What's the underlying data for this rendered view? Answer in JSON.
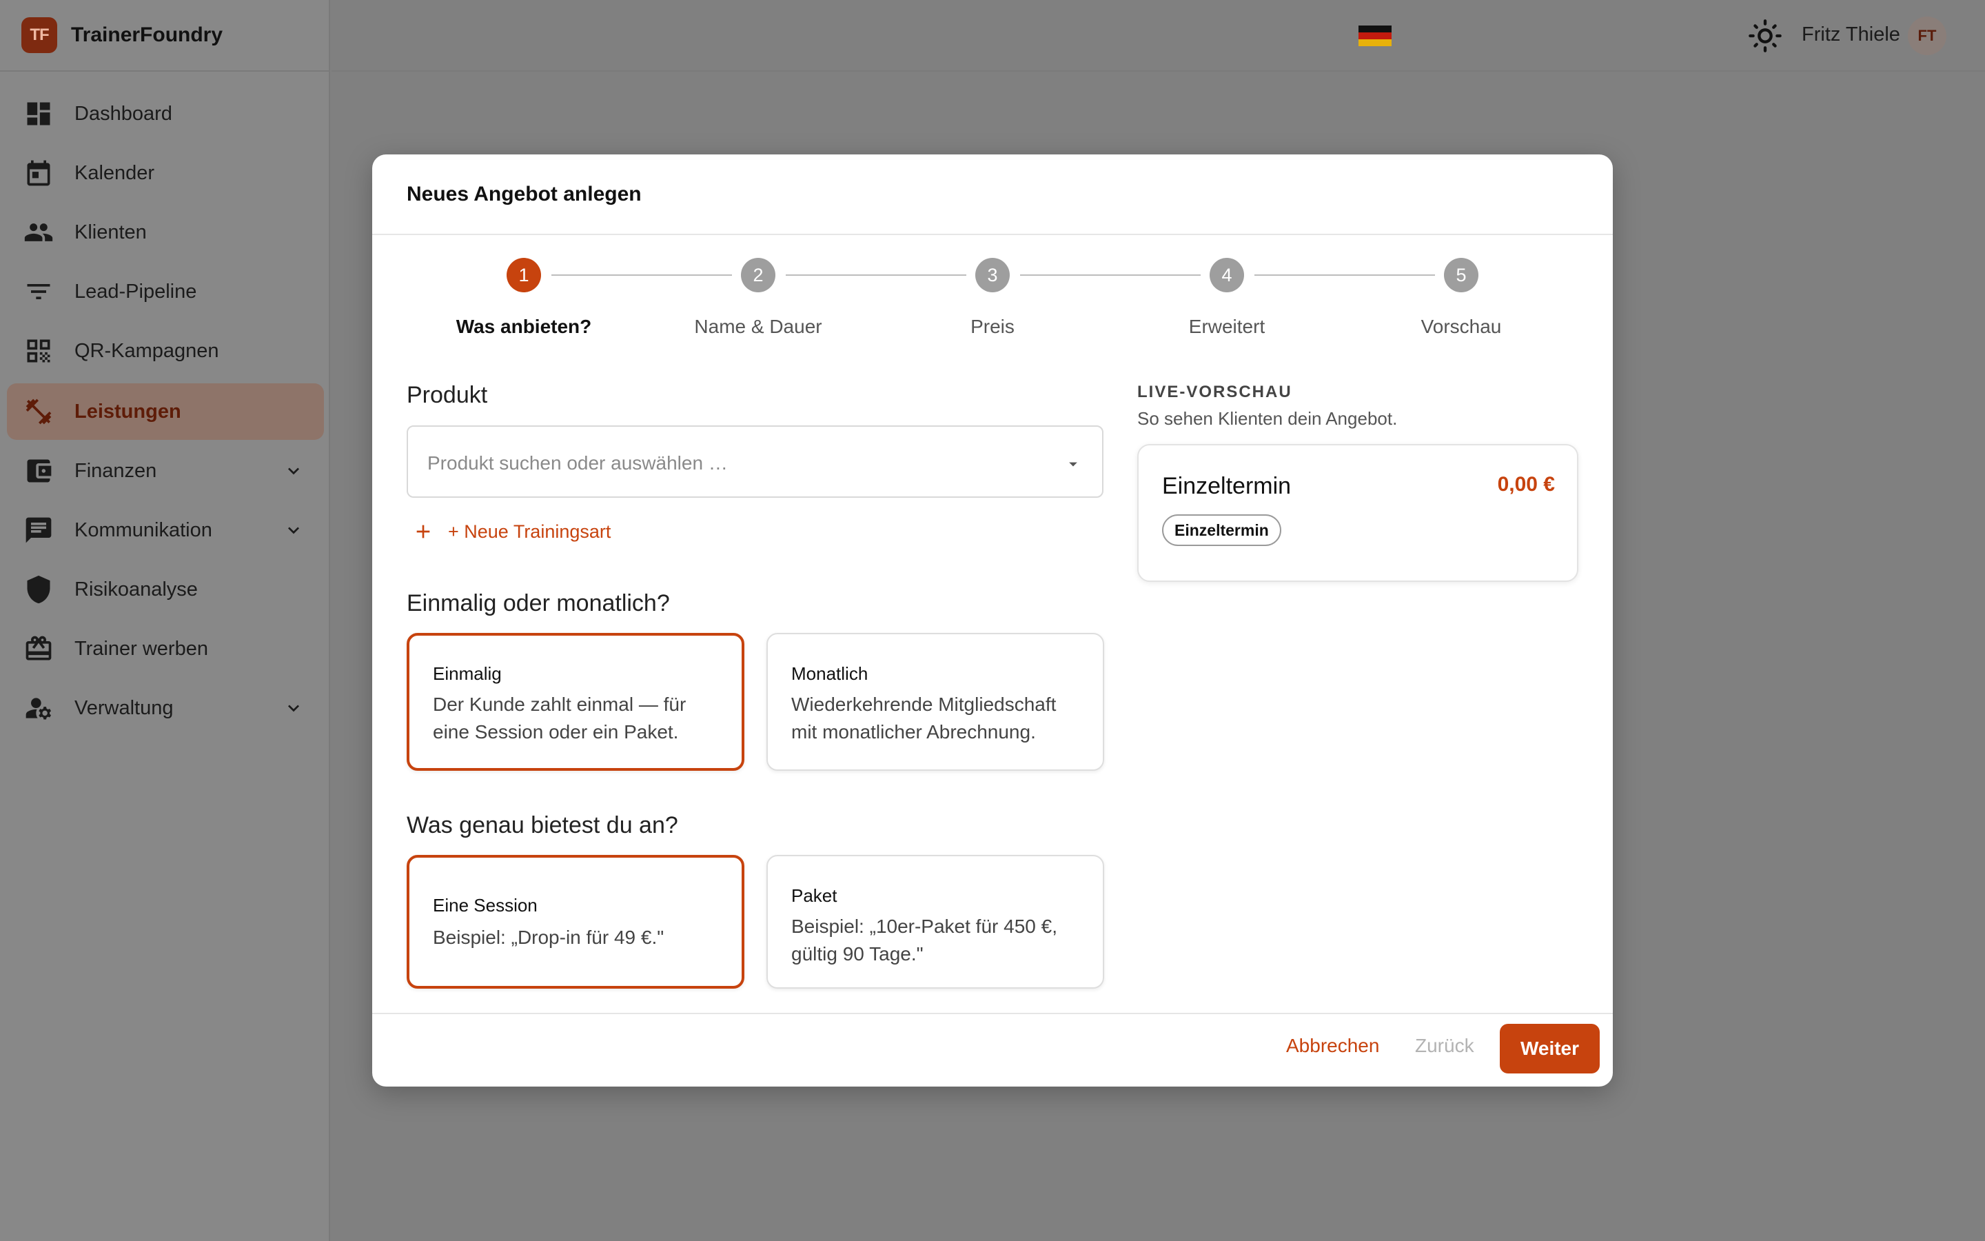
{
  "app": {
    "logo": "TF",
    "name": "TrainerFoundry"
  },
  "sidebar": {
    "items": [
      {
        "label": "Dashboard",
        "icon": "dashboard-icon"
      },
      {
        "label": "Kalender",
        "icon": "calendar-icon"
      },
      {
        "label": "Klienten",
        "icon": "people-icon"
      },
      {
        "label": "Lead-Pipeline",
        "icon": "filter-icon"
      },
      {
        "label": "QR-Kampagnen",
        "icon": "qr-code-icon"
      },
      {
        "label": "Leistungen",
        "icon": "dumbbell-icon",
        "active": true
      },
      {
        "label": "Finanzen",
        "icon": "wallet-icon",
        "expandable": true
      },
      {
        "label": "Kommunikation",
        "icon": "chat-icon",
        "expandable": true
      },
      {
        "label": "Risikoanalyse",
        "icon": "shield-icon"
      },
      {
        "label": "Trainer werben",
        "icon": "gift-icon"
      },
      {
        "label": "Verwaltung",
        "icon": "user-settings-icon",
        "expandable": true
      }
    ]
  },
  "topbar": {
    "language_flag": "de-flag-icon",
    "theme_icon": "sun-icon",
    "user_name": "Fritz Thiele",
    "avatar_initials": "FT"
  },
  "modal": {
    "title": "Neues Angebot anlegen",
    "steps": [
      {
        "number": "1",
        "label": "Was anbieten?",
        "active": true
      },
      {
        "number": "2",
        "label": "Name & Dauer"
      },
      {
        "number": "3",
        "label": "Preis"
      },
      {
        "number": "4",
        "label": "Erweitert"
      },
      {
        "number": "5",
        "label": "Vorschau"
      }
    ],
    "product": {
      "label": "Produkt",
      "placeholder": "Produkt suchen oder auswählen …",
      "new_link": "+ Neue Trainingsart"
    },
    "billing": {
      "question": "Einmalig oder monatlich?",
      "options": [
        {
          "title": "Einmalig",
          "desc": "Der Kunde zahlt einmal — für eine Session oder ein Paket.",
          "selected": true
        },
        {
          "title": "Monatlich",
          "desc": "Wiederkehrende Mitgliedschaft mit monatlicher Abrechnung."
        }
      ]
    },
    "offer_type": {
      "question": "Was genau bietest du an?",
      "options": [
        {
          "title": "Eine Session",
          "desc": "Beispiel: „Drop-in für 49 €.\"",
          "selected": true
        },
        {
          "title": "Paket",
          "desc": "Beispiel: „10er-Paket für 450 €, gültig 90 Tage.\""
        }
      ]
    },
    "preview": {
      "label": "LIVE-VORSCHAU",
      "subtitle": "So sehen Klienten dein Angebot.",
      "title": "Einzeltermin",
      "price": "0,00 €",
      "badge": "Einzeltermin"
    },
    "footer": {
      "cancel": "Abbrechen",
      "back": "Zurück",
      "next": "Weiter"
    }
  },
  "colors": {
    "accent": "#c7430e",
    "overlay": "#808080",
    "active_nav": "#8e7469"
  }
}
